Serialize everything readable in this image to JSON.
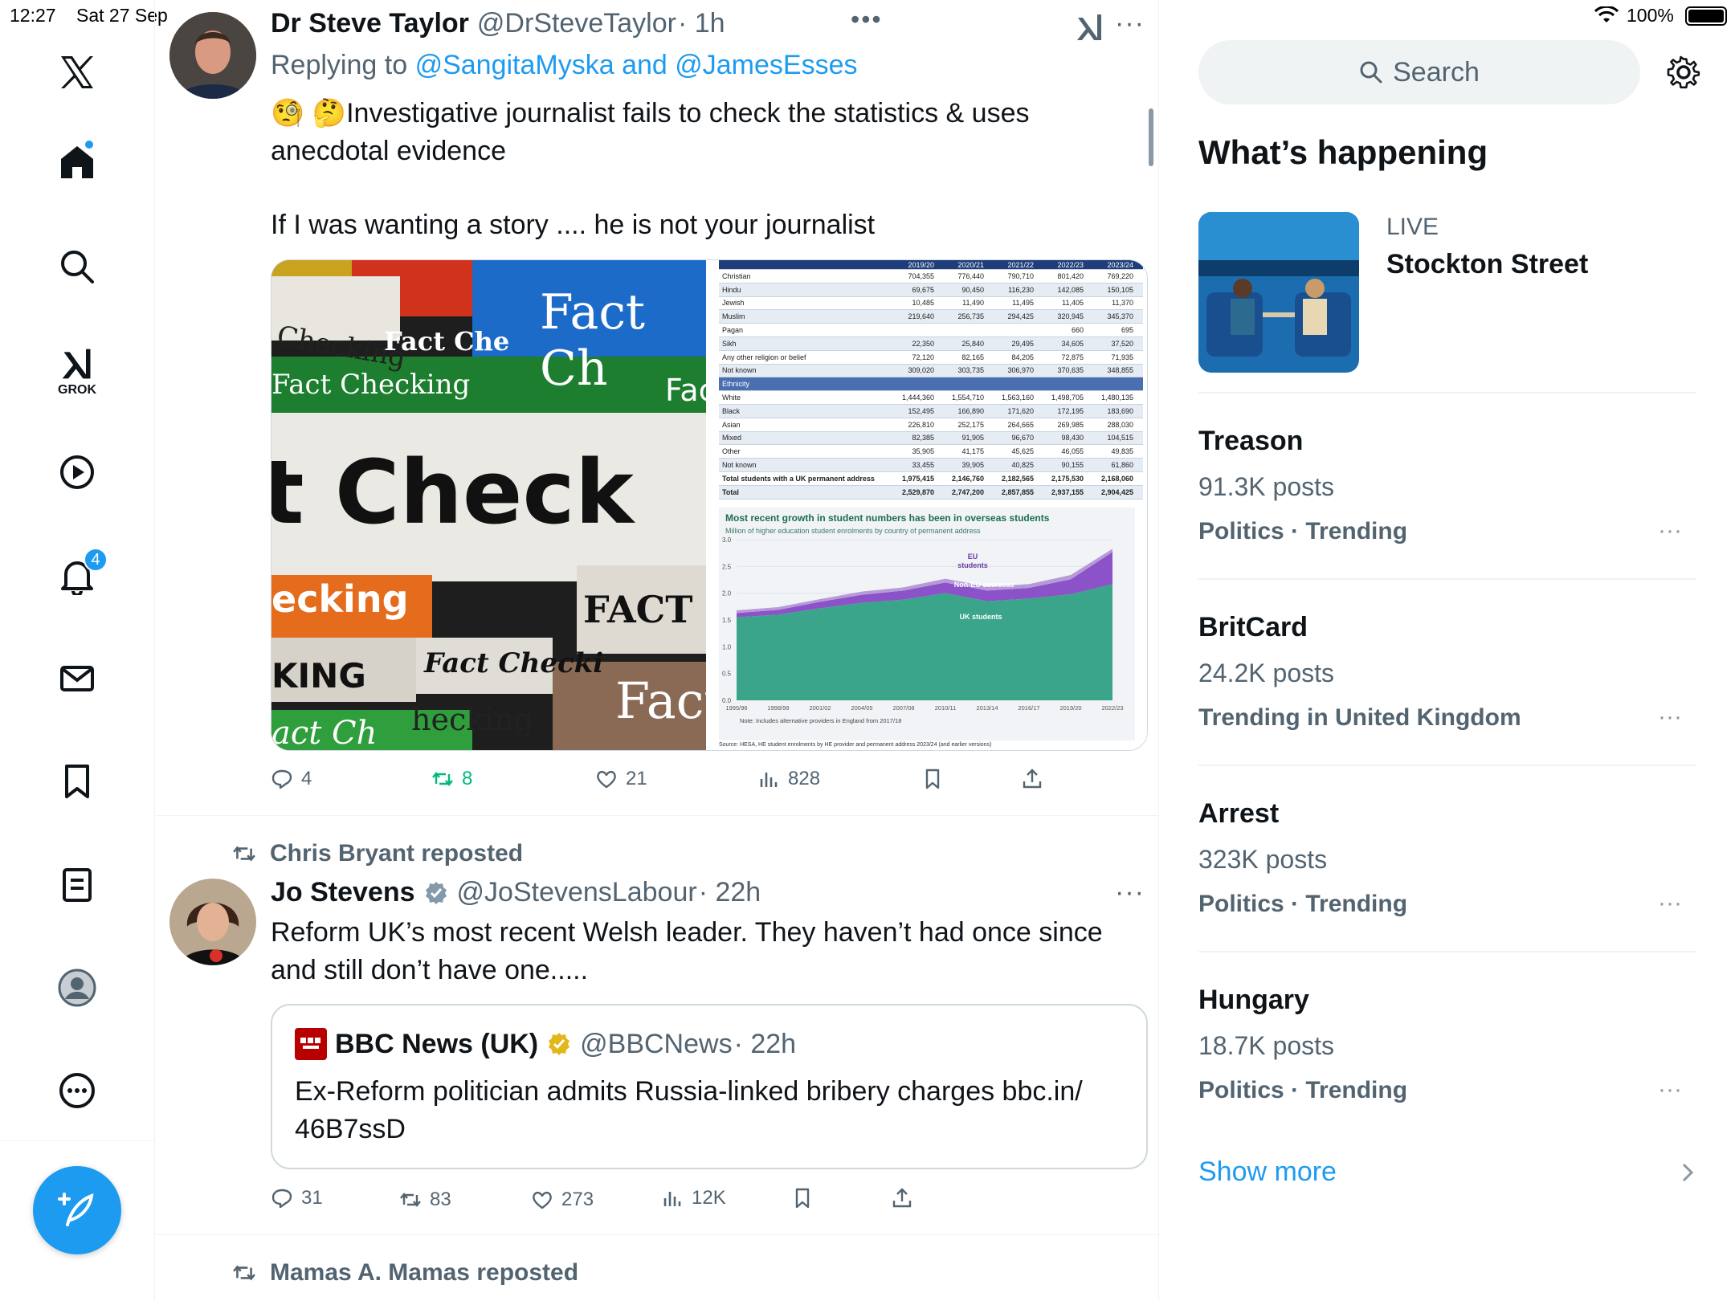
{
  "status_bar": {
    "time": "12:27",
    "date": "Sat 27 Sep",
    "battery": "100%"
  },
  "nav": {
    "grok_label": "GROK",
    "notifications_count": "4"
  },
  "tweet1": {
    "name": "Dr Steve Taylor",
    "handle": "@DrSteveTaylor",
    "time": "· 1h",
    "replying_prefix": "Replying to",
    "replying_to": "@SangitaMyska and @JamesEsses",
    "text_line1": "🧐 🤔Investigative journalist fails to check the statistics & uses",
    "text_line2": "anecdotal evidence",
    "text_line3": "If I was wanting a story .... he is not your journalist",
    "image_left_words": [
      "Fact Ch",
      "Checking",
      "Fact Che",
      "Fact Checking",
      "t Check",
      "ecking",
      "FACT",
      "KING",
      "Fact Checki",
      "Fact",
      "act Ch",
      "hecking",
      "Fac"
    ],
    "table": {
      "years": [
        "2019/20",
        "2020/21",
        "2021/22",
        "2022/23",
        "2023/24"
      ],
      "rows": [
        [
          "Christian",
          "704,355",
          "776,440",
          "790,710",
          "801,420",
          "769,220"
        ],
        [
          "Hindu",
          "69,675",
          "90,450",
          "116,230",
          "142,085",
          "150,105"
        ],
        [
          "Jewish",
          "10,485",
          "11,490",
          "11,495",
          "11,405",
          "11,370"
        ],
        [
          "Muslim",
          "219,640",
          "256,735",
          "294,425",
          "320,945",
          "345,370"
        ],
        [
          "Pagan",
          "",
          "",
          "",
          "660",
          "695"
        ],
        [
          "Sikh",
          "22,350",
          "25,840",
          "29,495",
          "34,605",
          "37,520"
        ],
        [
          "Any other religion or belief",
          "72,120",
          "82,165",
          "84,205",
          "72,875",
          "71,935"
        ],
        [
          "Not known",
          "309,020",
          "303,735",
          "306,970",
          "370,635",
          "348,855"
        ]
      ],
      "section": "Ethnicity",
      "rows2": [
        [
          "White",
          "1,444,360",
          "1,554,710",
          "1,563,160",
          "1,498,705",
          "1,480,135"
        ],
        [
          "Black",
          "152,495",
          "166,890",
          "171,620",
          "172,195",
          "183,690"
        ],
        [
          "Asian",
          "226,810",
          "252,175",
          "264,665",
          "269,985",
          "288,030"
        ],
        [
          "Mixed",
          "82,385",
          "91,905",
          "96,670",
          "98,430",
          "104,515"
        ],
        [
          "Other",
          "35,905",
          "41,175",
          "45,625",
          "46,055",
          "49,835"
        ],
        [
          "Not known",
          "33,455",
          "39,905",
          "40,825",
          "90,155",
          "61,860"
        ],
        [
          "Total students with a UK permanent address",
          "1,975,415",
          "2,146,760",
          "2,182,565",
          "2,175,530",
          "2,168,060"
        ],
        [
          "Total",
          "2,529,870",
          "2,747,200",
          "2,857,855",
          "2,937,155",
          "2,904,425"
        ]
      ]
    },
    "chart_data": {
      "type": "area",
      "title": "Most recent growth in student numbers has been in overseas students",
      "subtitle": "Million of higher education student enrolments by country of permanent address",
      "x": [
        "1995/96",
        "1998/99",
        "2001/02",
        "2004/05",
        "2007/08",
        "2010/11",
        "2013/14",
        "2016/17",
        "2019/20",
        "2022/23"
      ],
      "yticks": [
        "0.0",
        "0.5",
        "1.0",
        "1.5",
        "2.0",
        "2.5",
        "3.0"
      ],
      "ylim": [
        0,
        3.0
      ],
      "series": [
        {
          "name": "UK students",
          "values": [
            1.55,
            1.6,
            1.72,
            1.82,
            1.88,
            2.0,
            1.85,
            1.9,
            1.98,
            2.17
          ],
          "color": "#3aa58a"
        },
        {
          "name": "Non-EU overseas",
          "values": [
            0.08,
            0.09,
            0.12,
            0.15,
            0.17,
            0.2,
            0.2,
            0.2,
            0.28,
            0.6
          ],
          "color": "#8c52c8"
        },
        {
          "name": "EU students",
          "values": [
            0.05,
            0.05,
            0.05,
            0.06,
            0.06,
            0.07,
            0.07,
            0.07,
            0.08,
            0.06
          ],
          "color": "#b69ad8"
        }
      ],
      "labels": {
        "eu": "EU",
        "eu2": "students",
        "noneu": "Non-EU overseas",
        "uk": "UK students"
      },
      "note": "Note: Includes alternative providers in England from 2017/18",
      "source": "Source: HESA, HE student enrolments by HE provider and permanent address 2023/24 (and earlier versions)"
    },
    "replies": "4",
    "reposts": "8",
    "likes": "21",
    "views": "828"
  },
  "tweet2": {
    "repost_by": "Chris Bryant reposted",
    "name": "Jo Stevens",
    "handle": "@JoStevensLabour",
    "time": "· 22h",
    "text_line1": "Reform UK’s most recent Welsh leader. They haven’t had once since",
    "text_line2": "and still don’t have one.....",
    "quote": {
      "name": "BBC News (UK)",
      "handle": "@BBCNews",
      "time": "· 22h",
      "text_line1": "Ex-Reform politician admits Russia-linked bribery charges bbc.in/",
      "text_line2": "46B7ssD"
    },
    "replies": "31",
    "reposts": "83",
    "likes": "273",
    "views": "12K"
  },
  "tweet3": {
    "repost_by": "Mamas A. Mamas reposted"
  },
  "right": {
    "search_placeholder": "Search",
    "whats_happening": "What’s happening",
    "live_label": "LIVE",
    "live_title": "Stockton Street",
    "trends": [
      {
        "title": "Treason",
        "posts": "91.3K posts",
        "meta": "Politics · Trending"
      },
      {
        "title": "BritCard",
        "posts": "24.2K posts",
        "meta": "Trending in United Kingdom"
      },
      {
        "title": "Arrest",
        "posts": "323K posts",
        "meta": "Politics · Trending"
      },
      {
        "title": "Hungary",
        "posts": "18.7K posts",
        "meta": "Politics · Trending"
      }
    ],
    "show_more": "Show more"
  }
}
